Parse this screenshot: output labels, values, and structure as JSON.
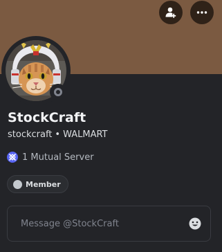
{
  "colors": {
    "background": "#232428",
    "banner": "#7b5a41",
    "accent": "#5865f2",
    "status_offline": "#80848e"
  },
  "banner": {
    "add_friend_icon": "add-friend-icon",
    "more_icon": "more-icon"
  },
  "profile": {
    "display_name": "StockCraft",
    "username": "stockcraft",
    "separator": "•",
    "tag": "WALMART",
    "status": "offline"
  },
  "mutual": {
    "icon": "server-icon",
    "label": "1 Mutual Server"
  },
  "roles": [
    {
      "label": "Member",
      "color": "#c4c9ce"
    }
  ],
  "message": {
    "placeholder": "Message @StockCraft",
    "value": "",
    "emoji_icon": "emoji-icon"
  }
}
